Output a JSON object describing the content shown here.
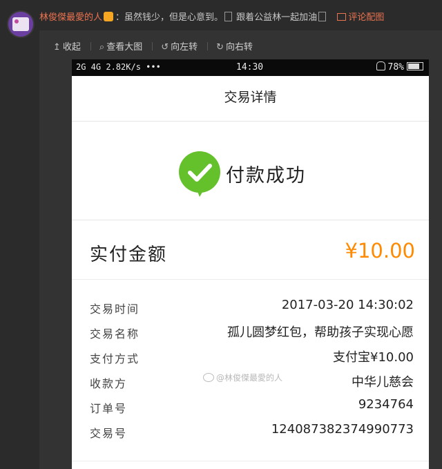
{
  "post": {
    "username": "林俊傑最愛的人",
    "text_part1": "：虽然钱少，但是心意到。",
    "text_part2": " 跟着公益林一起加油",
    "comment_pic_label": "评论配图"
  },
  "toolbar": {
    "collapse_label": "收起",
    "view_large_label": "查看大图",
    "rotate_left_label": "向左转",
    "rotate_right_label": "向右转"
  },
  "statusbar": {
    "signal": "2G 4G 2.82K/s •••",
    "time": "14:30",
    "battery_percent": "78%"
  },
  "screen": {
    "title": "交易详情",
    "success_text": "付款成功",
    "amount_label": "实付金额",
    "amount_value": "¥10.00"
  },
  "details": [
    {
      "label": "交易时间",
      "value": "2017-03-20 14:30:02"
    },
    {
      "label": "交易名称",
      "value": "孤儿圆梦红包，帮助孩子实现心愿"
    },
    {
      "label": "支付方式",
      "value": "支付宝¥10.00"
    },
    {
      "label": "收款方",
      "value": "中华儿慈会"
    },
    {
      "label": "订单号",
      "value": "9234764"
    },
    {
      "label": "交易号",
      "value": "124087382374990773"
    }
  ],
  "watermark": "@林俊傑最愛的人",
  "colors": {
    "accent": "#eb7350",
    "success_green": "#64c12b",
    "amount_orange": "#ff8a00"
  },
  "icons": [
    "avatar",
    "vip-icon",
    "picture-icon",
    "collapse-icon",
    "search-icon",
    "rotate-left-icon",
    "rotate-right-icon",
    "bell-off-icon",
    "battery-icon",
    "check-icon",
    "weibo-icon"
  ]
}
